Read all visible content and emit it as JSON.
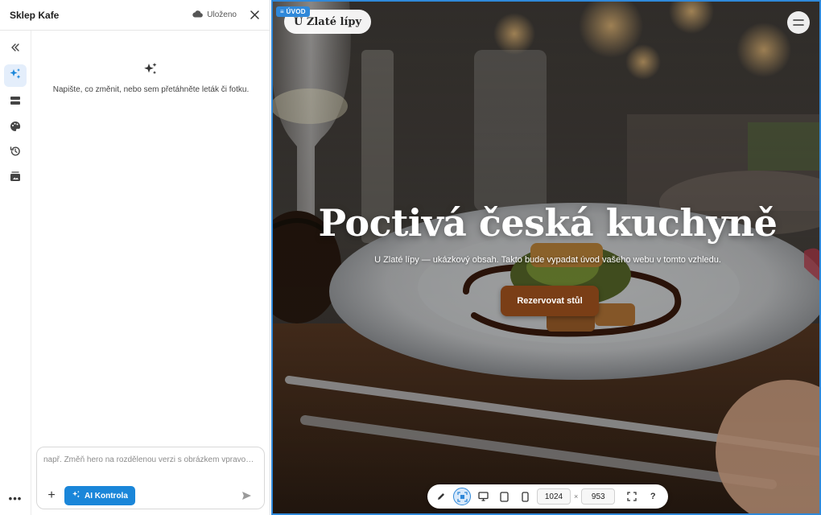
{
  "header": {
    "title": "Sklep Kafe",
    "save_status": "Uloženo"
  },
  "rail": {
    "items": [
      "collapse",
      "ai-assistant",
      "sections",
      "theme",
      "history",
      "media"
    ],
    "active": "ai-assistant"
  },
  "chat": {
    "empty_hint": "Napište, co změnit, nebo sem přetáhněte leták či fotku.",
    "input_placeholder": "např. Změň hero na rozdělenou verzi s obrázkem vpravo…",
    "ai_button_label": "AI Kontrola"
  },
  "preview": {
    "section_tag": "≡ ÚVOD",
    "brand": "U Zlaté lípy",
    "hero_title": "Poctivá česká kuchyně",
    "hero_subtitle": "U Zlaté lípy — ukázkový obsah. Takto bude vypadat úvod vašeho webu v tomto vzhledu.",
    "cta_label": "Rezervovat stůl"
  },
  "toolbar": {
    "width_value": "1024",
    "height_value": "953",
    "separator": "×",
    "help_label": "?"
  },
  "colors": {
    "accent": "#2f88d9",
    "cta": "#7a3e16",
    "active_rail": "#e4eefb"
  }
}
